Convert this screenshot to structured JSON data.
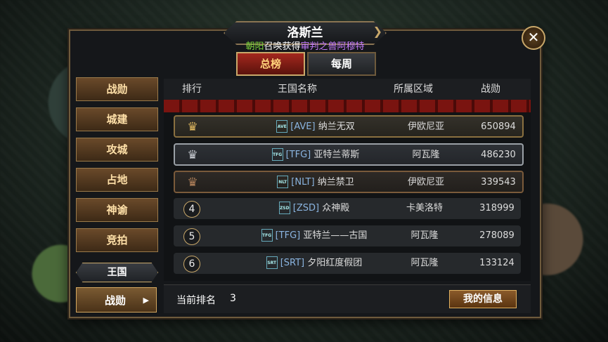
{
  "window": {
    "title": "洛斯兰"
  },
  "notice": {
    "player": "朝阳",
    "action": "召唤获得",
    "reward": "审判之兽阿穆特"
  },
  "tabs": [
    {
      "label": "总榜",
      "active": true
    },
    {
      "label": "每周",
      "active": false
    }
  ],
  "sidebar": {
    "items": [
      "战勋",
      "城建",
      "攻城",
      "占地",
      "神谕",
      "竞拍"
    ],
    "group": "王国",
    "sub": "战勋"
  },
  "table": {
    "headers": [
      "排行",
      "王国名称",
      "所属区域",
      "战勋"
    ],
    "rows": [
      {
        "rank": "1",
        "tag": "[AVE]",
        "emblem": "AVE",
        "name": "纳兰无双",
        "region": "伊欧尼亚",
        "power": "650894"
      },
      {
        "rank": "2",
        "tag": "[TFG]",
        "emblem": "TFG",
        "name": "亚特兰蒂斯",
        "region": "阿瓦隆",
        "power": "486230"
      },
      {
        "rank": "3",
        "tag": "[NLT]",
        "emblem": "NLT",
        "name": "纳兰禁卫",
        "region": "伊欧尼亚",
        "power": "339543"
      },
      {
        "rank": "4",
        "tag": "[ZSD]",
        "emblem": "ZSD",
        "name": "众神殿",
        "region": "卡美洛特",
        "power": "318999"
      },
      {
        "rank": "5",
        "tag": "[TFG]",
        "emblem": "TFG",
        "name": "亚特兰——古国",
        "region": "阿瓦隆",
        "power": "278089"
      },
      {
        "rank": "6",
        "tag": "[SRT]",
        "emblem": "SRT",
        "name": "夕阳红度假团",
        "region": "阿瓦隆",
        "power": "133124"
      }
    ]
  },
  "footer": {
    "current_rank_label": "当前排名",
    "current_rank": "3",
    "my_info_label": "我的信息"
  },
  "icons": {
    "close": "close-icon",
    "crown": "crown-icon",
    "arrow": "arrow-right-icon"
  }
}
